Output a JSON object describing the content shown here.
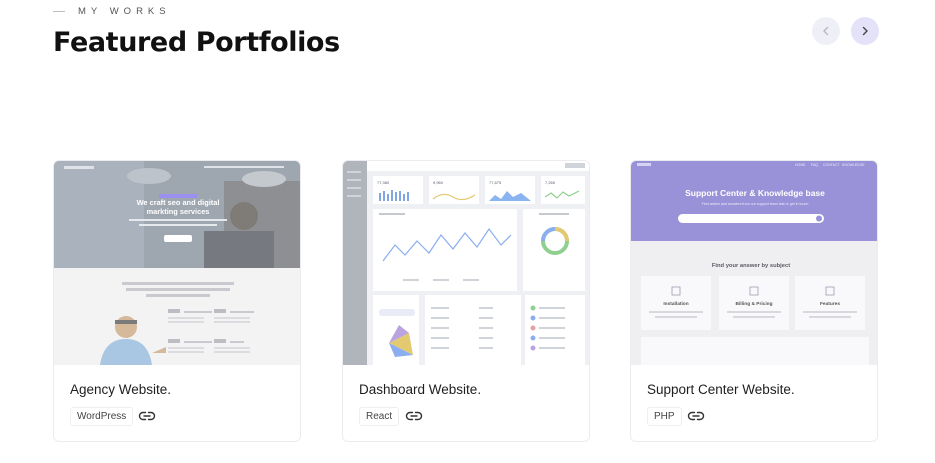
{
  "header": {
    "eyebrow": "MY WORKS",
    "title": "Featured Portfolios"
  },
  "navigation": {
    "prev_icon": "chevron-left-icon",
    "next_icon": "chevron-right-icon"
  },
  "colors": {
    "accent_light": "#e4e2f9",
    "card_border": "#ececf0"
  },
  "portfolios": [
    {
      "title": "Agency Website.",
      "tag": "WordPress",
      "link_icon": "link-icon",
      "preview": {
        "hero_title": "We craft seo and digital markting services",
        "tagline": "We are creative digital marketing agency with expertise to grow any business that need proper guidance and a committed service.",
        "services": [
          "01 Management",
          "02 Strategy",
          "03 Experience",
          "04 SEO"
        ]
      }
    },
    {
      "title": "Dashboard Website.",
      "tag": "React",
      "link_icon": "link-icon",
      "preview": {
        "stats": [
          "77,380",
          "9,960",
          "77,875",
          "7,265"
        ]
      }
    },
    {
      "title": "Support Center Website.",
      "tag": "PHP",
      "link_icon": "link-icon",
      "preview": {
        "nav": [
          "HOME",
          "FAQ",
          "CONTACT",
          "KNOWLEDGE"
        ],
        "hero_title": "Support Center & Knowledge base",
        "hero_sub": "Find advice and answers from our support team fast or get in touch",
        "section_title": "Find your answer by subject",
        "topics": [
          "Installation",
          "Billing & Pricing",
          "Features"
        ]
      }
    }
  ]
}
